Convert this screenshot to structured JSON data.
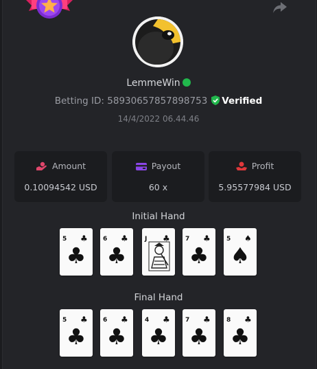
{
  "user": {
    "name": "LemmeWin",
    "betting_id_label": "Betting ID:",
    "betting_id": "58930657857898753",
    "verified_label": "Verified",
    "datetime": "14/4/2022 06.44.46"
  },
  "stats": {
    "amount": {
      "label": "Amount",
      "value": "0.10094542 USD"
    },
    "payout": {
      "label": "Payout",
      "value": "60 x"
    },
    "profit": {
      "label": "Profit",
      "value": "5.95577984 USD"
    }
  },
  "initial_hand": {
    "title": "Initial Hand",
    "cards": [
      {
        "rank": "5",
        "suit": "♣"
      },
      {
        "rank": "6",
        "suit": "♣"
      },
      {
        "rank": "J",
        "suit": "♣"
      },
      {
        "rank": "7",
        "suit": "♣"
      },
      {
        "rank": "5",
        "suit": "♠"
      }
    ]
  },
  "final_hand": {
    "title": "Final Hand",
    "cards": [
      {
        "rank": "5",
        "suit": "♣"
      },
      {
        "rank": "6",
        "suit": "♣"
      },
      {
        "rank": "4",
        "suit": "♣"
      },
      {
        "rank": "7",
        "suit": "♣"
      },
      {
        "rank": "8",
        "suit": "♣"
      }
    ]
  },
  "colors": {
    "online": "#21b74c",
    "verified": "#21b74c",
    "amount_icon": "#e0466b",
    "payout_icon": "#8b45e8",
    "profit_icon": "#e0383b"
  },
  "icons": {
    "badge": "star-ribbon-badge",
    "share": "share-arrow-icon"
  }
}
